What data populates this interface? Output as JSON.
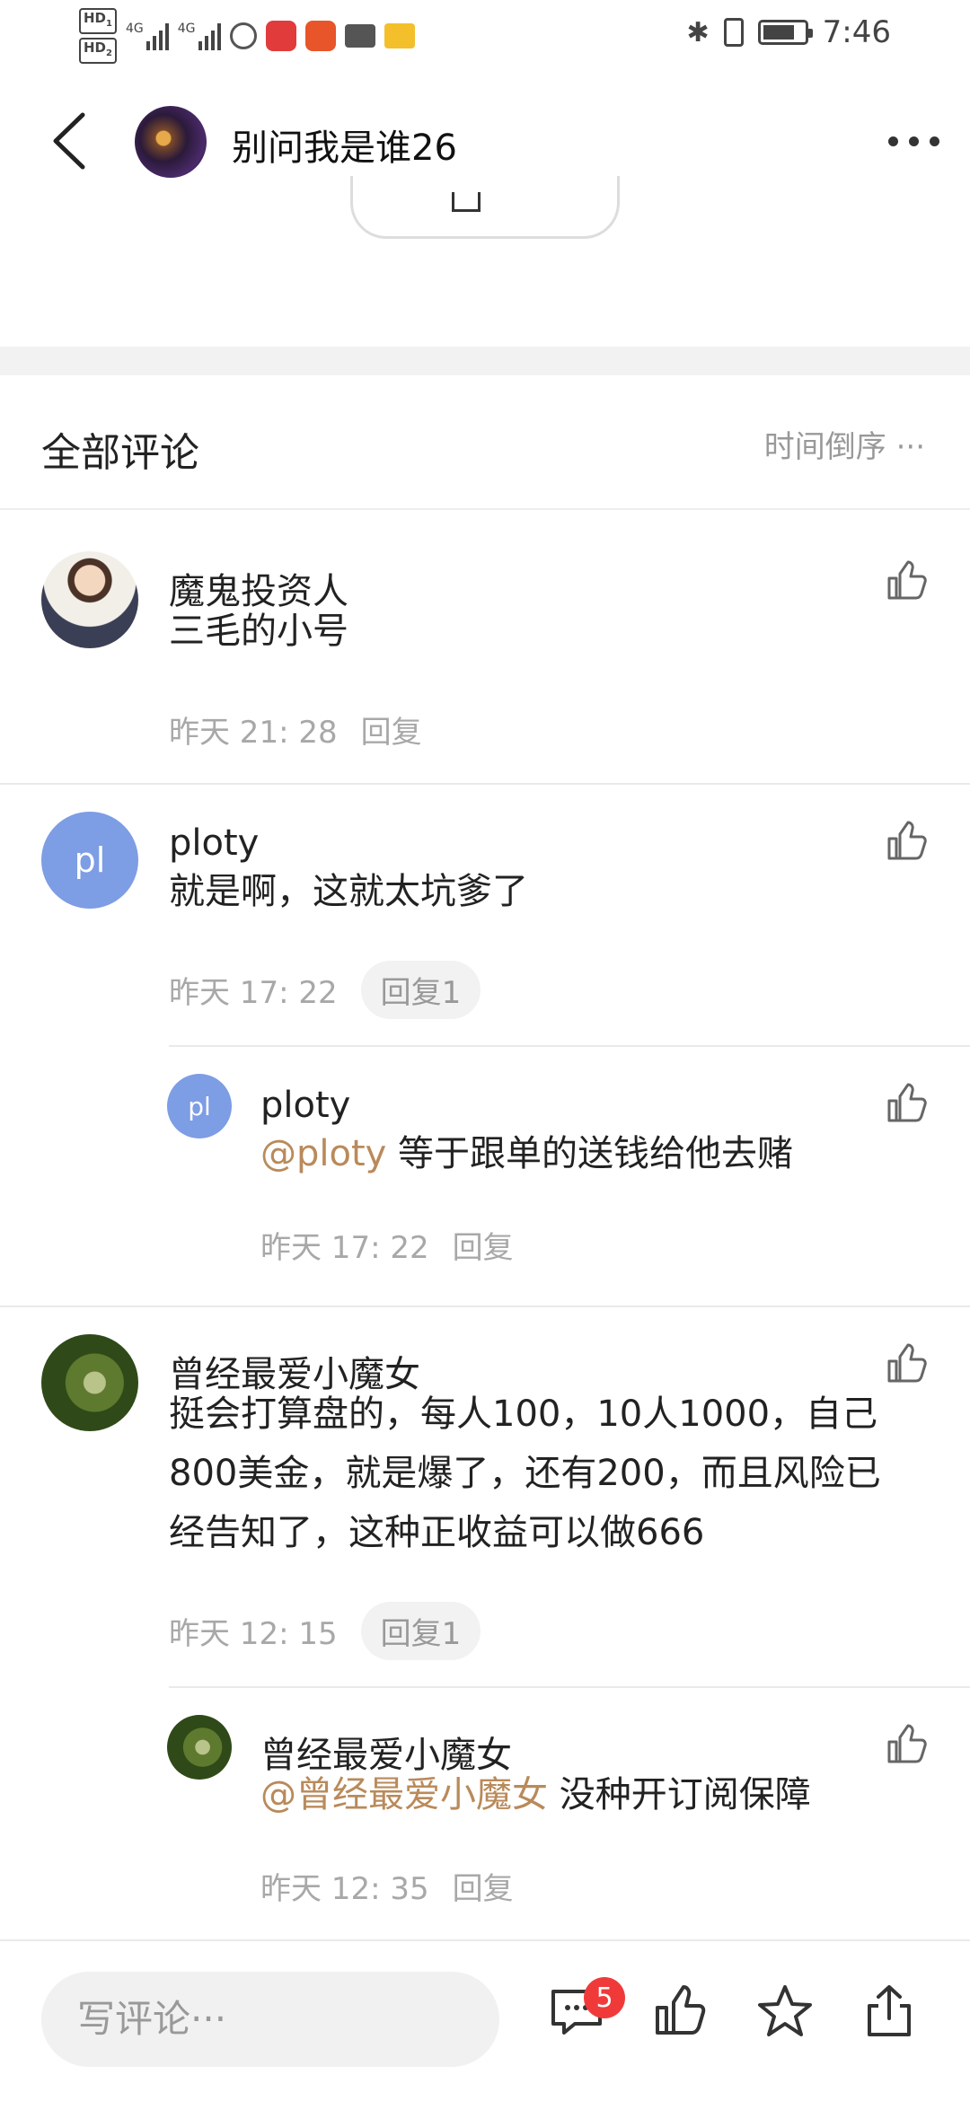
{
  "status_bar": {
    "hd1": "HD",
    "hd1_sub": "1",
    "hd2": "HD",
    "hd2_sub": "2",
    "net1": "4G",
    "net2": "4G",
    "time": "7:46"
  },
  "header": {
    "title": "别问我是谁26"
  },
  "section": {
    "title": "全部评论",
    "sort_label": "时间倒序 ···"
  },
  "comments": [
    {
      "name": "魔鬼投资人",
      "text": "三毛的小号",
      "time": "昨天 21: 28",
      "reply_label": "回复"
    },
    {
      "name": "ploty",
      "avatar_letters": "pl",
      "text": "就是啊，这就太坑爹了",
      "time": "昨天 17: 22",
      "reply_label": "回复1",
      "replies": [
        {
          "name": "ploty",
          "avatar_letters": "pl",
          "mention": "@ploty",
          "text": " 等于跟单的送钱给他去赌",
          "time": "昨天 17: 22",
          "reply_label": "回复"
        }
      ]
    },
    {
      "name": "曾经最爱小魔女",
      "text_lines": [
        "挺会打算盘的，每人100，10人1000，自己",
        "800美金，就是爆了，还有200，而且风险已",
        "经告知了，这种正收益可以做666"
      ],
      "time": "昨天 12: 15",
      "reply_label": "回复1",
      "replies": [
        {
          "name": "曾经最爱小魔女",
          "mention": "@曾经最爱小魔女",
          "text": " 没种开订阅保障",
          "time": "昨天 12: 35",
          "reply_label": "回复"
        }
      ]
    }
  ],
  "bottom_bar": {
    "input_placeholder": "写评论···",
    "comment_count": "5"
  },
  "colors": {
    "mention": "#b98a5a",
    "badge": "#f03a3a",
    "avatar_letter_bg": "#7d9de4"
  }
}
